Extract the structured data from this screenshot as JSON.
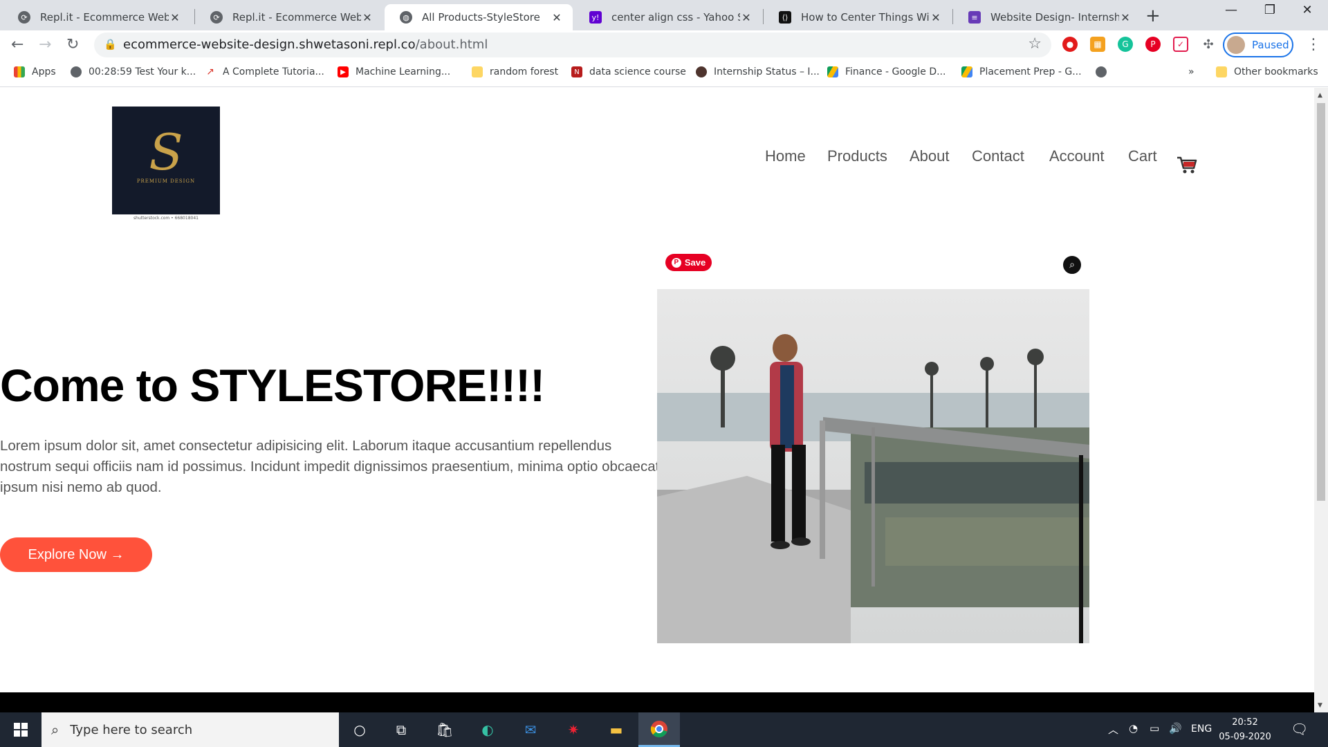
{
  "browser": {
    "tabs": [
      {
        "title": "Repl.it - Ecommerce Website",
        "favicon": "replit-icon",
        "active": false
      },
      {
        "title": "Repl.it - Ecommerce Website",
        "favicon": "replit-icon",
        "active": false
      },
      {
        "title": "All Products-StyleStore",
        "favicon": "globe-icon",
        "active": true
      },
      {
        "title": "center align css - Yahoo Sear",
        "favicon": "yahoo-icon",
        "active": false
      },
      {
        "title": "How to Center Things With S",
        "favicon": "code-icon",
        "active": false
      },
      {
        "title": "Website Design- Internship F",
        "favicon": "form-icon",
        "active": false
      }
    ],
    "url_host": "ecommerce-website-design.shwetasoni.repl.co",
    "url_path": "/about.html",
    "profile_status": "Paused",
    "bookmarks": [
      {
        "label": "Apps",
        "icon": "apps-grid-icon"
      },
      {
        "label": "00:28:59 Test Your k...",
        "icon": "globe-icon"
      },
      {
        "label": "A Complete Tutoria...",
        "icon": "chart-icon"
      },
      {
        "label": "Machine Learning...",
        "icon": "youtube-icon"
      },
      {
        "label": "random forest",
        "icon": "folder-icon"
      },
      {
        "label": "data science course",
        "icon": "n-icon"
      },
      {
        "label": "Internship Status – I...",
        "icon": "brown-circle-icon"
      },
      {
        "label": "Finance - Google D...",
        "icon": "drive-icon"
      },
      {
        "label": "Placement Prep - G...",
        "icon": "drive-icon"
      }
    ],
    "bookmarks_overflow": "»",
    "other_bookmarks": "Other bookmarks"
  },
  "site": {
    "logo_brand": "PREMIUM DESIGN",
    "logo_caption": "shutterstock.com • 668018041",
    "nav": [
      "Home",
      "Products",
      "About",
      "Contact",
      "Account",
      "Cart"
    ],
    "hero_title": "Come to STYLESTORE!!!!",
    "hero_text": "Lorem ipsum dolor sit, amet consectetur adipisicing elit. Laborum itaque accusantium repellendus nostrum sequi officiis nam id possimus. Incidunt impedit dignissimos praesentium, minima optio obcaecati ipsum nisi nemo ab quod.",
    "explore_label": "Explore Now →",
    "pinterest_save": "Save",
    "accent_color": "#ff523b"
  },
  "taskbar": {
    "search_placeholder": "Type here to search",
    "language": "ENG",
    "time": "20:52",
    "date": "05-09-2020"
  }
}
